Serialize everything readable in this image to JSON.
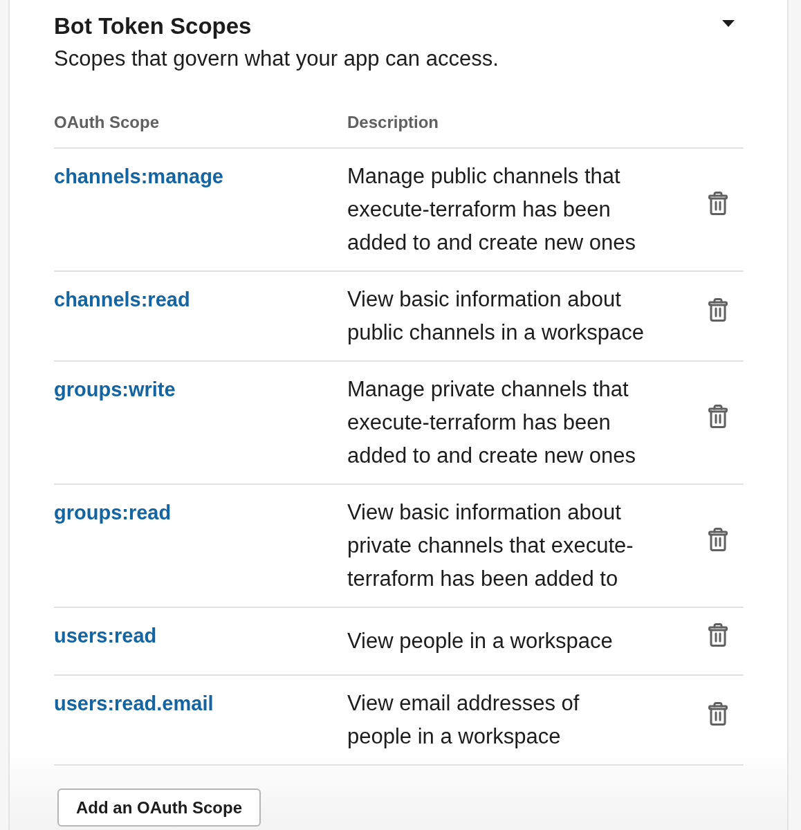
{
  "section": {
    "title": "Bot Token Scopes",
    "subtitle": "Scopes that govern what your app can access.",
    "expanded": true
  },
  "table": {
    "columns": [
      "OAuth Scope",
      "Description"
    ],
    "rows": [
      {
        "scope": "channels:manage",
        "description": "Manage public channels that execute-terraform has been added to and create new ones"
      },
      {
        "scope": "channels:read",
        "description": "View basic information about public channels in a workspace"
      },
      {
        "scope": "groups:write",
        "description": "Manage private channels that execute-terraform has been added to and create new ones"
      },
      {
        "scope": "groups:read",
        "description": "View basic information about private channels that execute-terraform has been added to"
      },
      {
        "scope": "users:read",
        "description": "View people in a workspace"
      },
      {
        "scope": "users:read.email",
        "description": "View email addresses of people in a workspace"
      }
    ]
  },
  "add_button": "Add an OAuth Scope"
}
